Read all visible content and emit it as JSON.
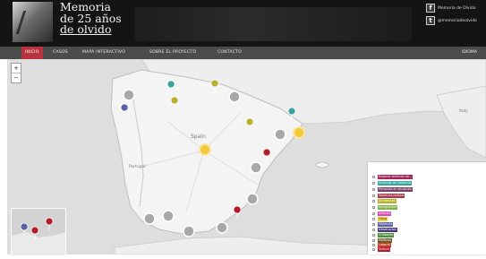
{
  "header": {
    "title_lines": [
      "Memoria",
      "de 25 años",
      "de olvido"
    ],
    "social": [
      {
        "icon": "facebook-icon",
        "glyph": "f",
        "label": "Memoria de Olvido"
      },
      {
        "icon": "twitter-icon",
        "glyph": "t",
        "label": "@memoriadeolvido"
      }
    ]
  },
  "nav": {
    "items": [
      "INICIO",
      "CASOS",
      "MAPA INTERACTIVO",
      "SOBRE EL PROYECTO",
      "CONTACTO"
    ],
    "active": "INICIO",
    "right_label": "IDIOMA"
  },
  "map": {
    "zoom_in": "+",
    "zoom_out": "−",
    "labels": {
      "spain": "Spain",
      "portugal": "Portugal",
      "italy": "Italy"
    },
    "colors": {
      "land": "#f2f2f2",
      "sea": "#dedede",
      "cluster": "#a9a9a9",
      "cluster_yellow": "#f2c739"
    }
  },
  "legend": {
    "items": [
      {
        "label": "Mujeres víctimas de...",
        "color": "#a3245b"
      },
      {
        "label": "Víctimas de violencia",
        "color": "#3ba4a0"
      },
      {
        "label": "Personas en situación",
        "color": "#7a3e6a"
      },
      {
        "label": "Violencia policial",
        "color": "#a63a4a"
      },
      {
        "label": "Accidentes",
        "color": "#b7b02a"
      },
      {
        "label": "Inmigrantes",
        "color": "#7fb04a"
      },
      {
        "label": "Infancia",
        "color": "#e048b5"
      },
      {
        "label": "Otros",
        "color": "#f0d340"
      },
      {
        "label": "Violencia",
        "color": "#5a5fa8"
      },
      {
        "label": "Desahucios",
        "color": "#4a3a7a"
      },
      {
        "label": "Crímenes",
        "color": "#4c8e3a"
      },
      {
        "label": "Políticos",
        "color": "#6e5a2a"
      },
      {
        "label": "Laboral",
        "color": "#c43b2a"
      },
      {
        "label": "Tortura",
        "color": "#b11d2b"
      }
    ],
    "footer": "Fuente: Memoria de 25 años"
  }
}
